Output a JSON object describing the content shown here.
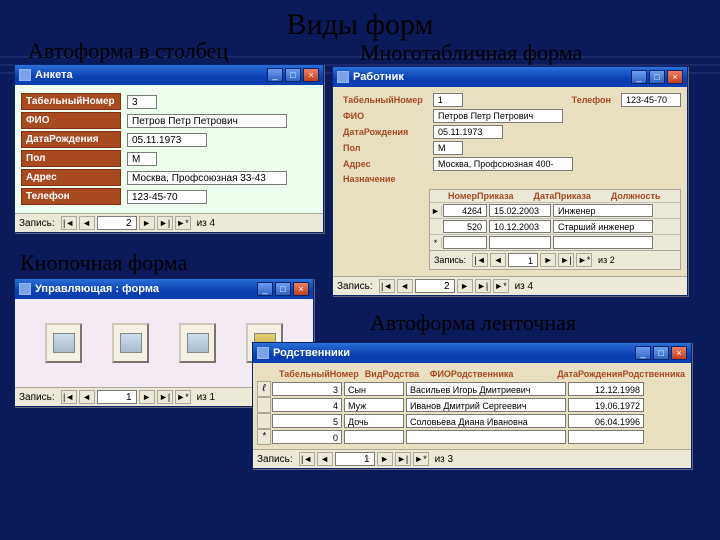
{
  "title": "Виды форм",
  "labels": {
    "columnar": "Автоформа в столбец",
    "multitable": "Многотабличная форма",
    "button": "Кнопочная форма",
    "ribbon": "Автоформа ленточная"
  },
  "nav": {
    "label": "Запись:",
    "first": "|◄",
    "prev": "◄",
    "next": "►",
    "last": "►|",
    "new": "►*",
    "of_prefix": "из "
  },
  "win_buttons": {
    "min": "_",
    "max": "□",
    "close": "×"
  },
  "columnar_form": {
    "window_title": "Анкета",
    "fields": [
      {
        "label": "ТабельныйНомер",
        "value": "3"
      },
      {
        "label": "ФИО",
        "value": "Петров Петр Петрович"
      },
      {
        "label": "ДатаРождения",
        "value": "05.11.1973"
      },
      {
        "label": "Пол",
        "value": "М"
      },
      {
        "label": "Адрес",
        "value": "Москва, Профсоюзная 33-43"
      },
      {
        "label": "Телефон",
        "value": "123-45-70"
      }
    ],
    "record_no": "2",
    "record_total": "4"
  },
  "multitable_form": {
    "window_title": "Работник",
    "fields_left": [
      {
        "label": "ТабельныйНомер",
        "value": "1"
      },
      {
        "label": "ФИО",
        "value": "Петров Петр Петрович"
      },
      {
        "label": "ДатаРождения",
        "value": "05.11.1973"
      },
      {
        "label": "Пол",
        "value": "М"
      },
      {
        "label": "Адрес",
        "value": "Москва, Профсоюзная 400-"
      }
    ],
    "phone_label": "Телефон",
    "phone_value": "123-45-70",
    "subform_label": "Назначение",
    "subform_headers": [
      "НомерПриказа",
      "ДатаПриказа",
      "Должность"
    ],
    "subform_rows": [
      {
        "sel": "►",
        "c1": "4264",
        "c2": "15.02.2003",
        "c3": "Инженер"
      },
      {
        "sel": "",
        "c1": "520",
        "c2": "10.12.2003",
        "c3": "Старший инженер"
      },
      {
        "sel": "*",
        "c1": "",
        "c2": "",
        "c3": ""
      }
    ],
    "sub_record_no": "1",
    "sub_record_total": "2",
    "record_no": "2",
    "record_total": "4"
  },
  "button_form": {
    "window_title": "Управляющая : форма",
    "record_no": "1",
    "record_total": "1"
  },
  "ribbon_form": {
    "window_title": "Родственники",
    "headers": [
      "ТабельныйНомер",
      "ВидРодства",
      "ФИОРодственника",
      "ДатаРожденияРодственника"
    ],
    "rows": [
      {
        "sel": "ℓ",
        "c1": "3",
        "c2": "Сын",
        "c3": "Васильев Игорь Дмитриевич",
        "c4": "12.12.1998"
      },
      {
        "sel": "",
        "c1": "4",
        "c2": "Муж",
        "c3": "Иванов Дмитрий Сергеевич",
        "c4": "19.06.1972"
      },
      {
        "sel": "",
        "c1": "5",
        "c2": "Дочь",
        "c3": "Соловьева Диана Ивановна",
        "c4": "06.04.1996"
      },
      {
        "sel": "*",
        "c1": "0",
        "c2": "",
        "c3": "",
        "c4": ""
      }
    ],
    "record_no": "1",
    "record_total": "3"
  }
}
